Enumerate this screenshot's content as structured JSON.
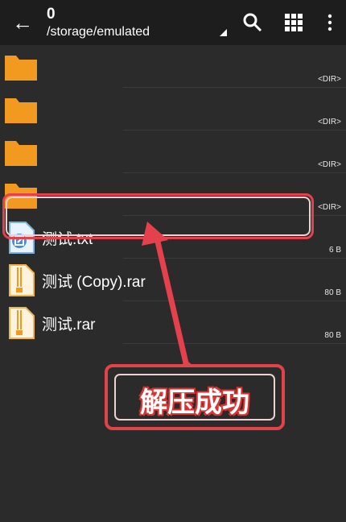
{
  "header": {
    "title": "0",
    "path": "/storage/emulated",
    "icons": [
      "back-arrow-icon",
      "search-icon",
      "grid-view-icon",
      "more-icon"
    ]
  },
  "files": [
    {
      "name": "",
      "meta": "<DIR>",
      "type": "folder"
    },
    {
      "name": "",
      "meta": "<DIR>",
      "type": "folder"
    },
    {
      "name": "",
      "meta": "<DIR>",
      "type": "folder"
    },
    {
      "name": "",
      "meta": "<DIR>",
      "type": "folder"
    },
    {
      "name": "测试.txt",
      "meta": "6 B",
      "type": "text"
    },
    {
      "name": "测试 (Copy).rar",
      "meta": "80 B",
      "type": "archive"
    },
    {
      "name": "测试.rar",
      "meta": "80 B",
      "type": "archive"
    }
  ],
  "annotation": {
    "text": "解压成功",
    "color": "#e5414c"
  }
}
